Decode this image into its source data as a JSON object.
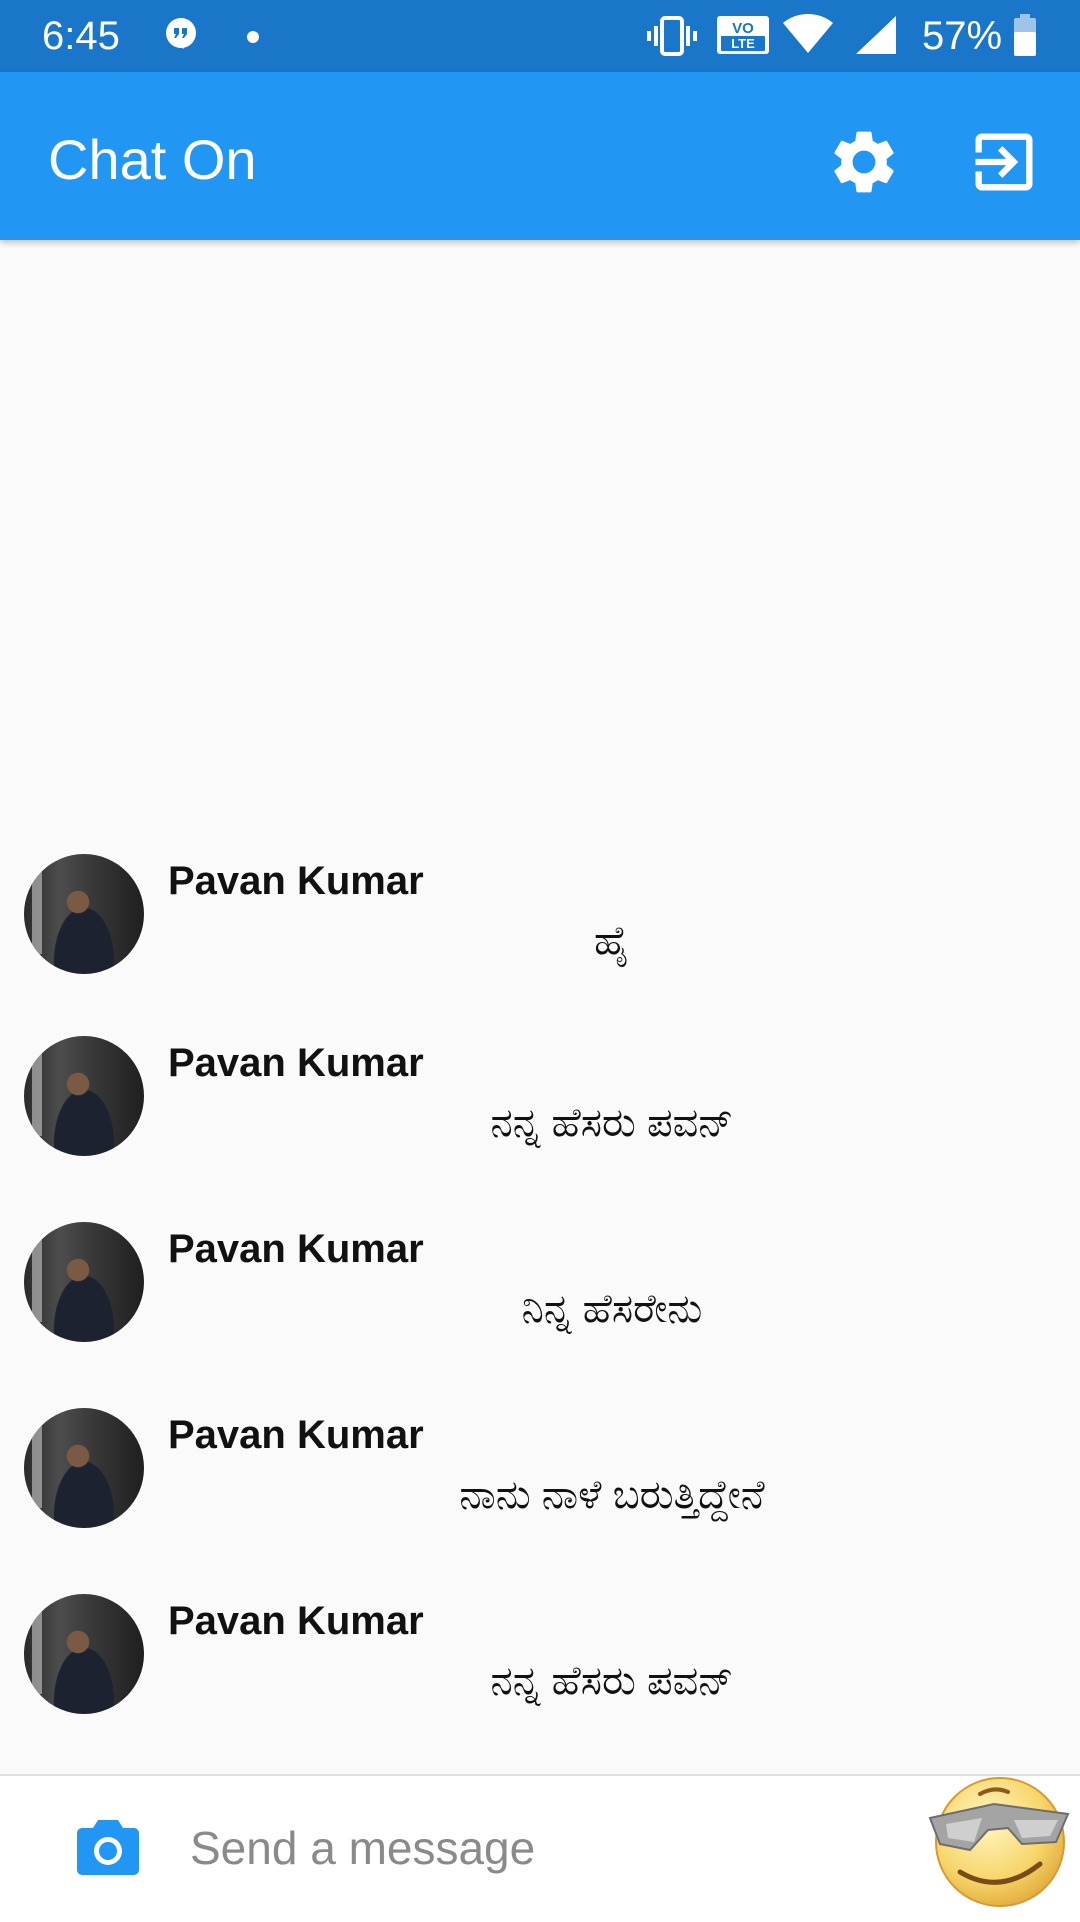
{
  "status_bar": {
    "time": "6:45",
    "battery_percent": "57%",
    "icons": [
      "chat-notification-icon",
      "dot-icon",
      "vibrate-icon",
      "volte-icon",
      "wifi-icon",
      "signal-icon",
      "battery-icon"
    ],
    "volte_top": "VO",
    "volte_bottom": "LTE"
  },
  "app_bar": {
    "title": "Chat On",
    "icons": [
      "gear-icon",
      "logout-icon"
    ],
    "color": "#2196f3"
  },
  "messages": [
    {
      "sender": "Pavan Kumar",
      "text": "ಹೈ"
    },
    {
      "sender": "Pavan Kumar",
      "text": "ನನ್ನ ಹೆಸರು ಪವನ್"
    },
    {
      "sender": "Pavan Kumar",
      "text": "ನಿನ್ನ ಹೆಸರೇನು"
    },
    {
      "sender": "Pavan Kumar",
      "text": "ನಾನು ನಾಳೆ ಬರುತ್ತಿದ್ದೇನೆ"
    },
    {
      "sender": "Pavan Kumar",
      "text": "ನನ್ನ ಹೆಸರು ಪವನ್"
    }
  ],
  "composer": {
    "placeholder": "Send a message",
    "icons": [
      "camera-icon",
      "cool-emoji-icon"
    ],
    "accent": "#2196f3"
  }
}
